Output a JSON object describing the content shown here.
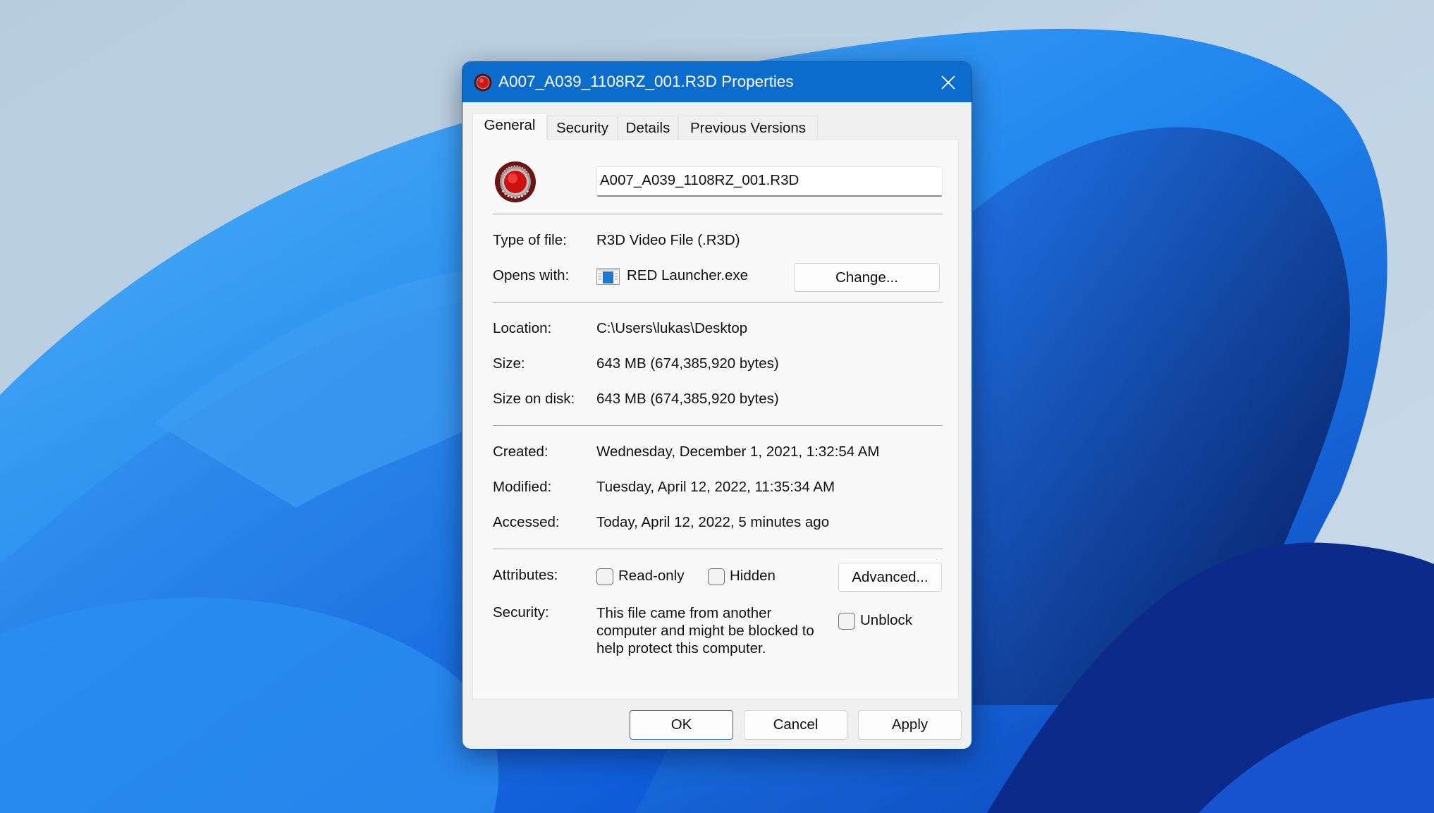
{
  "dialog": {
    "title": "A007_A039_1108RZ_001.R3D Properties",
    "title_icon": "red-player-icon",
    "close_icon": "close-icon",
    "accent_color": "#0b6ccb"
  },
  "tabs": [
    {
      "label": "General",
      "active": true
    },
    {
      "label": "Security",
      "active": false
    },
    {
      "label": "Details",
      "active": false
    },
    {
      "label": "Previous Versions",
      "active": false
    }
  ],
  "general": {
    "file_icon": "red-player-icon",
    "file_name": "A007_A039_1108RZ_001.R3D",
    "type_of_file": {
      "label": "Type of file:",
      "value": "R3D Video File (.R3D)"
    },
    "opens_with": {
      "label": "Opens with:",
      "value": "RED Launcher.exe",
      "icon": "app-window-icon",
      "change_button": "Change..."
    },
    "location": {
      "label": "Location:",
      "value": "C:\\Users\\lukas\\Desktop"
    },
    "size": {
      "label": "Size:",
      "value": "643 MB (674,385,920 bytes)"
    },
    "size_on_disk": {
      "label": "Size on disk:",
      "value": "643 MB (674,385,920 bytes)"
    },
    "created": {
      "label": "Created:",
      "value": "Wednesday, December 1, 2021, 1:32:54 AM"
    },
    "modified": {
      "label": "Modified:",
      "value": "Tuesday, April 12, 2022, 11:35:34 AM"
    },
    "accessed": {
      "label": "Accessed:",
      "value": "Today, April 12, 2022, 5 minutes ago"
    },
    "attributes": {
      "label": "Attributes:",
      "read_only": {
        "label": "Read-only",
        "checked": false
      },
      "hidden": {
        "label": "Hidden",
        "checked": false
      },
      "advanced_button": "Advanced..."
    },
    "security": {
      "label": "Security:",
      "message": "This file came from another computer and might be blocked to help protect this computer.",
      "unblock": {
        "label": "Unblock",
        "checked": false
      }
    }
  },
  "footer": {
    "ok": "OK",
    "cancel": "Cancel",
    "apply": "Apply"
  }
}
